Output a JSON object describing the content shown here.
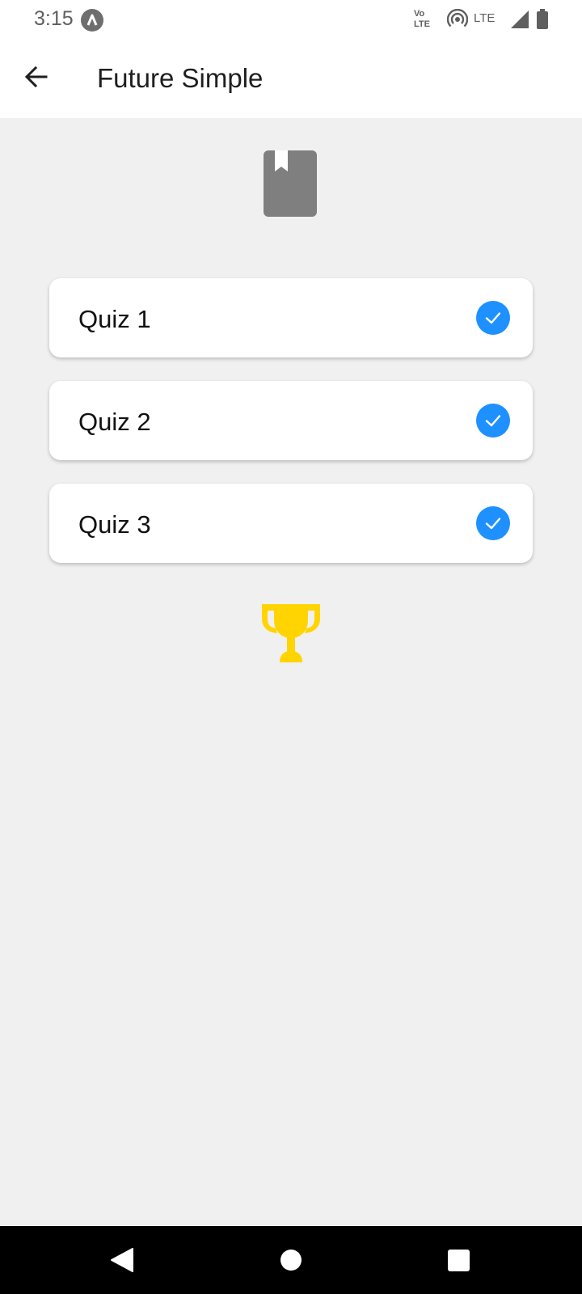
{
  "status_bar": {
    "time": "3:15",
    "volte_line1": "Vo",
    "volte_line2": "LTE",
    "network_label": "LTE"
  },
  "app_bar": {
    "title": "Future Simple"
  },
  "quizzes": [
    {
      "label": "Quiz 1",
      "completed": true
    },
    {
      "label": "Quiz 2",
      "completed": true
    },
    {
      "label": "Quiz 3",
      "completed": true
    }
  ],
  "colors": {
    "check_blue": "#1e90ff",
    "trophy_gold": "#ffd400",
    "book_gray": "#7f7f7f",
    "background": "#f0f0f0"
  },
  "icons": {
    "header_icon": "book-bookmark-icon",
    "reward_icon": "trophy-icon",
    "completed_icon": "check-circle-icon"
  }
}
